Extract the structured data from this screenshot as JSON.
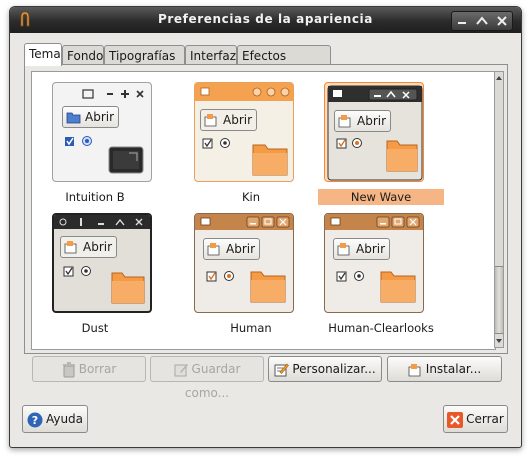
{
  "window": {
    "title": "Preferencias de la apariencia"
  },
  "tabs": [
    {
      "label": "Tema",
      "active": true
    },
    {
      "label": "Fondo"
    },
    {
      "label": "Tipografías"
    },
    {
      "label": "Interfaz"
    },
    {
      "label": "Efectos visuales"
    }
  ],
  "themes": [
    {
      "name": "Intuition B",
      "selected": false,
      "preview_button": "Abrir"
    },
    {
      "name": "Kin",
      "selected": false,
      "preview_button": "Abrir"
    },
    {
      "name": "New Wave",
      "selected": true,
      "preview_button": "Abrir"
    },
    {
      "name": "Dust",
      "selected": false,
      "preview_button": "Abrir"
    },
    {
      "name": "Human",
      "selected": false,
      "preview_button": "Abrir"
    },
    {
      "name": "Human-Clearlooks",
      "selected": false,
      "preview_button": "Abrir"
    }
  ],
  "actions": {
    "delete": "Borrar",
    "save_as": "Guardar como...",
    "customize": "Personalizar...",
    "install": "Instalar..."
  },
  "footer": {
    "help": "Ayuda",
    "close": "Cerrar"
  },
  "colors": {
    "selection": "#f6b585",
    "orange": "#f0893a",
    "titlebar": "#2b2b2b"
  }
}
